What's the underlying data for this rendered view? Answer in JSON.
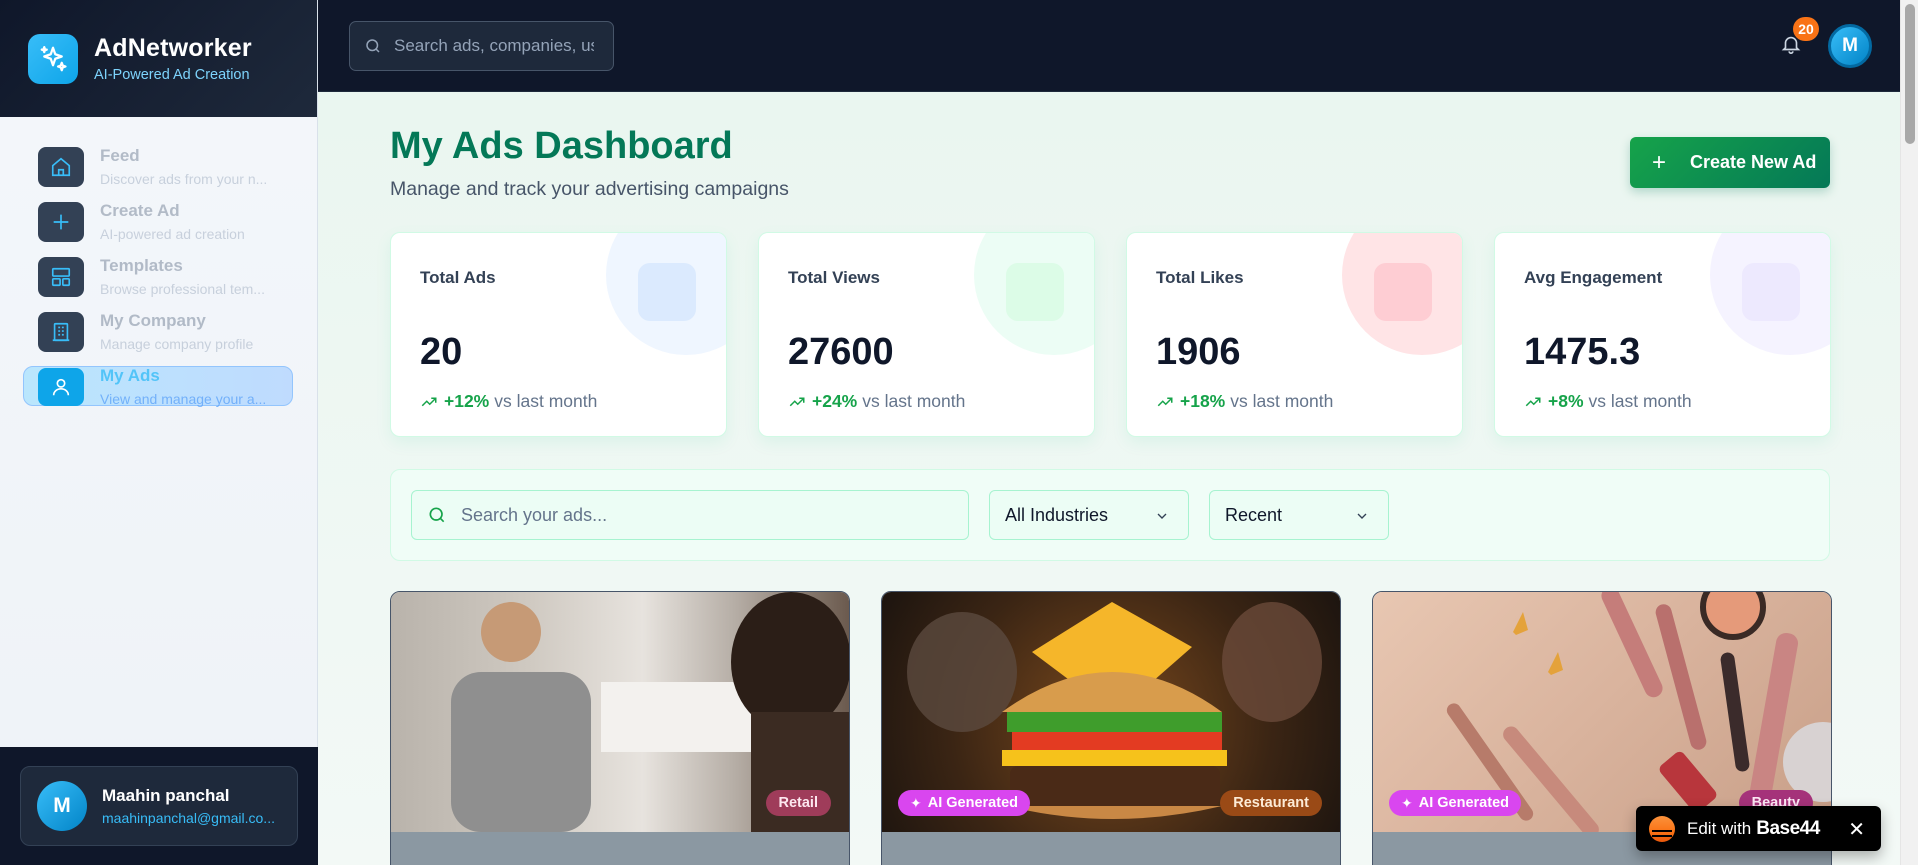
{
  "brand": {
    "name": "AdNetworker",
    "tagline": "AI-Powered Ad Creation"
  },
  "sidebar": {
    "items": [
      {
        "label": "Feed",
        "description": "Discover ads from your n...",
        "icon": "home-icon"
      },
      {
        "label": "Create Ad",
        "description": "AI-powered ad creation",
        "icon": "plus-icon"
      },
      {
        "label": "Templates",
        "description": "Browse professional tem...",
        "icon": "layout-icon"
      },
      {
        "label": "My Company",
        "description": "Manage company profile",
        "icon": "building-icon"
      },
      {
        "label": "My Ads",
        "description": "View and manage your a...",
        "icon": "user-icon",
        "active": true
      }
    ],
    "user": {
      "initial": "M",
      "name": "Maahin panchal",
      "email": "maahinpanchal@gmail.co..."
    }
  },
  "topbar": {
    "search_placeholder": "Search ads, companies, us",
    "notifications_count": "20",
    "avatar_initial": "M"
  },
  "main": {
    "title": "My Ads Dashboard",
    "subtitle": "Manage and track your advertising campaigns",
    "create_button": "Create New Ad",
    "stats": [
      {
        "label": "Total Ads",
        "value": "20",
        "change": "+12%",
        "suffix": "vs last month",
        "accent": "#dbeafe"
      },
      {
        "label": "Total Views",
        "value": "27600",
        "change": "+24%",
        "suffix": "vs last month",
        "accent": "#dcfce7"
      },
      {
        "label": "Total Likes",
        "value": "1906",
        "change": "+18%",
        "suffix": "vs last month",
        "accent": "#ffe4e6"
      },
      {
        "label": "Avg Engagement",
        "value": "1475.3",
        "change": "+8%",
        "suffix": "vs last month",
        "accent": "#ede9fe"
      }
    ],
    "filters": {
      "search_placeholder": "Search your ads...",
      "industry": "All Industries",
      "sort": "Recent"
    },
    "ads": [
      {
        "industry": "Retail",
        "ai_generated": false
      },
      {
        "industry": "Restaurant",
        "ai_generated": true,
        "ai_label": "AI Generated"
      },
      {
        "industry": "Beauty",
        "ai_generated": true,
        "ai_label": "AI Generated"
      }
    ]
  },
  "base44": {
    "prefix": "Edit with",
    "brand": "Base44"
  },
  "colors": {
    "accent_green": "#047857",
    "brand_blue": "#0ea5e9",
    "badge_orange": "#f97316",
    "ai_pink": "#d946ef"
  }
}
